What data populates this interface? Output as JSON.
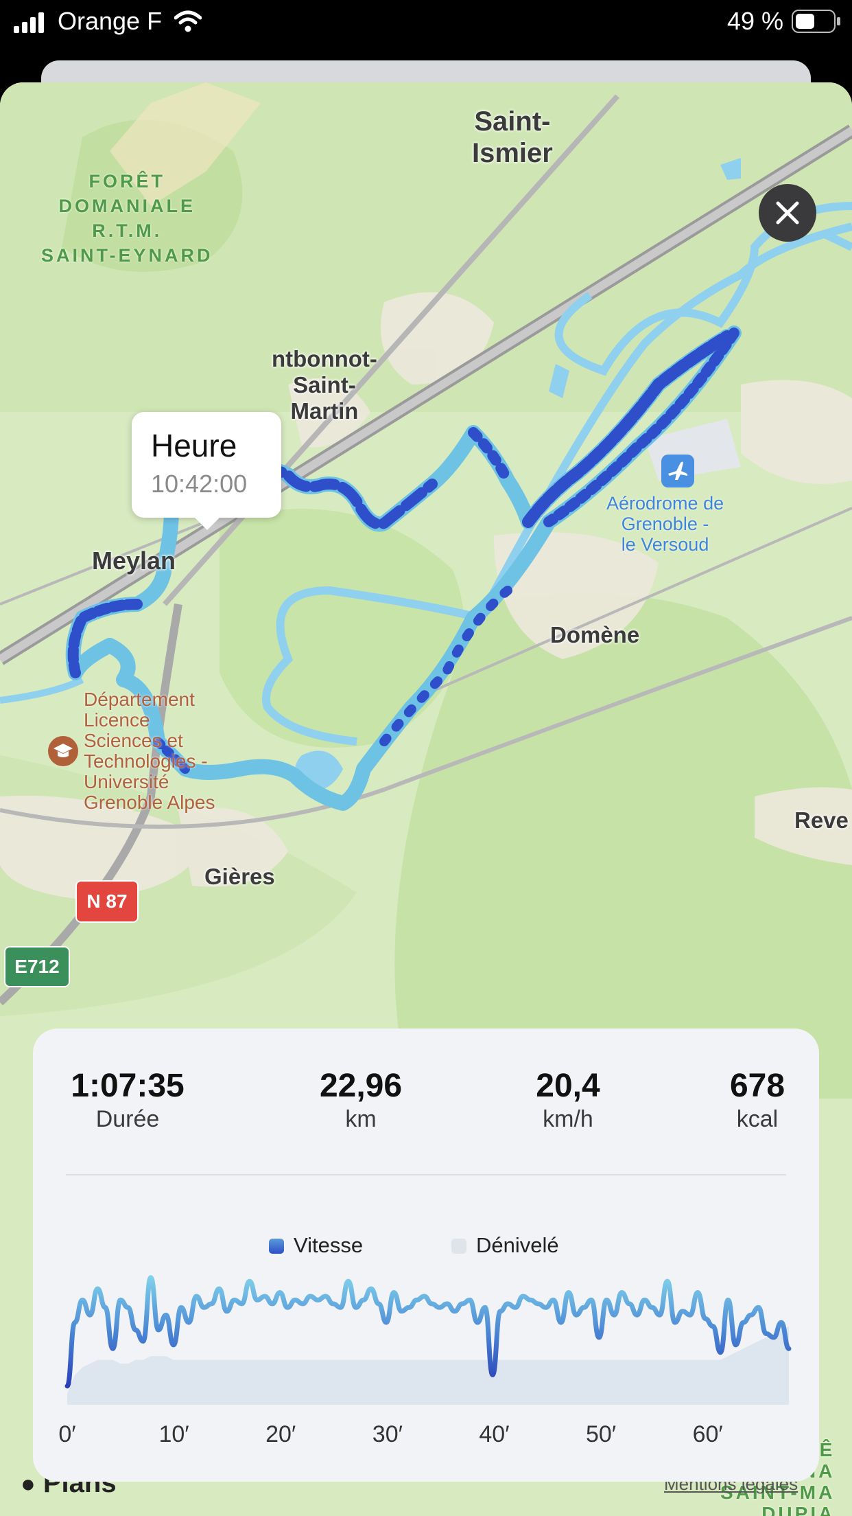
{
  "status_bar": {
    "carrier": "Orange F",
    "battery": "49 %"
  },
  "map": {
    "labels": {
      "saint_ismier": "Saint-\nIsmier",
      "foret": "FORÊT\nDOMANIALE\nR.T.M.\nSAINT-EYNARD",
      "montbonnot": "ntbonnot-\nSaint-\nMartin",
      "meylan": "Meylan",
      "aerodrome": "Aérodrome de\nGrenoble -\nle Versoud",
      "domene": "Domène",
      "departement": "Département\nLicence\nSciences et\nTechnologies -\nUniversité\nGrenoble Alpes",
      "gieres": "Gières",
      "reve": "Reve",
      "n87": "N 87",
      "e712": "E712",
      "bottom_right": "RÊ\nONA\nSAINT-MA\nDUPIA"
    },
    "tooltip": {
      "title": "Heure",
      "time": "10:42:00"
    },
    "colors": {
      "route_dark": "#2e4fc9",
      "route_light": "#6ec2e4",
      "water": "#8fd0ee",
      "park": "#c8e4a9"
    }
  },
  "stats": [
    {
      "value": "1:07:35",
      "unit": "Durée"
    },
    {
      "value": "22,96",
      "unit": "km"
    },
    {
      "value": "20,4",
      "unit": "km/h"
    },
    {
      "value": "678",
      "unit": "kcal"
    }
  ],
  "chart_data": {
    "type": "line",
    "series": [
      {
        "name": "Vitesse",
        "values": [
          5,
          22,
          28,
          24,
          31,
          26,
          15,
          28,
          26,
          20,
          17,
          34,
          20,
          24,
          16,
          26,
          22,
          29,
          26,
          27,
          31,
          25,
          28,
          27,
          33,
          28,
          29,
          27,
          30,
          26,
          28,
          27,
          29,
          28,
          29,
          27,
          26,
          33,
          26,
          28,
          31,
          27,
          22,
          30,
          25,
          26,
          28,
          29,
          27,
          26,
          27,
          25,
          27,
          28,
          22,
          26,
          8,
          25,
          27,
          26,
          29,
          28,
          27,
          26,
          28,
          22,
          30,
          24,
          26,
          28,
          18,
          28,
          24,
          30,
          27,
          24,
          28,
          26,
          24,
          33,
          22,
          25,
          24,
          30,
          23,
          21,
          14,
          28,
          16,
          22,
          24,
          26,
          19,
          18,
          22,
          15
        ]
      },
      {
        "name": "Dénivelé",
        "values": [
          3,
          8,
          10,
          11,
          12,
          12,
          12,
          11,
          11,
          12,
          12,
          13,
          13,
          13,
          12,
          12,
          12,
          12,
          12,
          12,
          12,
          12,
          12,
          12,
          12,
          12,
          12,
          12,
          12,
          12,
          12,
          12,
          12,
          12,
          12,
          12,
          12,
          12,
          12,
          12,
          12,
          12,
          12,
          12,
          12,
          12,
          12,
          12,
          12,
          12,
          12,
          12,
          12,
          12,
          12,
          12,
          12,
          12,
          12,
          12,
          12,
          12,
          12,
          12,
          12,
          12,
          12,
          12,
          12,
          12,
          12,
          12,
          12,
          12,
          12,
          12,
          12,
          12,
          12,
          12,
          12,
          12,
          12,
          12,
          12,
          12,
          12,
          13,
          14,
          15,
          16,
          17,
          18,
          19,
          20,
          21
        ]
      }
    ],
    "x_ticks": [
      "0′",
      "10′",
      "20′",
      "30′",
      "40′",
      "50′",
      "60′"
    ],
    "xlim": [
      0,
      67.6
    ],
    "ylim": [
      0,
      40
    ],
    "legend": "top"
  },
  "footer": {
    "brand": "Plans",
    "legal": "Mentions légales"
  }
}
